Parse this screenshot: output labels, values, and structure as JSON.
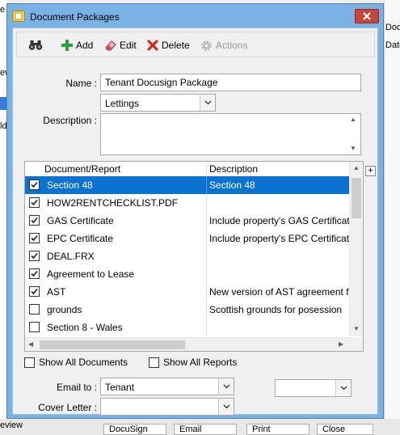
{
  "window": {
    "title": "Document Packages"
  },
  "toolbar": {
    "add_label": "Add",
    "edit_label": "Edit",
    "delete_label": "Delete",
    "actions_label": "Actions"
  },
  "form": {
    "name_label": "Name :",
    "name_value": "Tenant Docusign Package",
    "category_value": "Lettings",
    "description_label": "Description :",
    "description_value": ""
  },
  "grid": {
    "columns": [
      "Document/Report",
      "Description"
    ],
    "rows": [
      {
        "name": "Section 48",
        "description": "Section 48",
        "checked": true,
        "selected": true
      },
      {
        "name": "HOW2RENTCHECKLIST.PDF",
        "description": "",
        "checked": true,
        "selected": false
      },
      {
        "name": "GAS Certificate",
        "description": "Include property's GAS Certificat",
        "checked": true,
        "selected": false
      },
      {
        "name": "EPC Certificate",
        "description": "Include property's EPC Certificat",
        "checked": true,
        "selected": false
      },
      {
        "name": "DEAL.FRX",
        "description": "",
        "checked": true,
        "selected": false
      },
      {
        "name": "Agreement to Lease",
        "description": "",
        "checked": true,
        "selected": false
      },
      {
        "name": "AST",
        "description": "New version of AST agreement fo",
        "checked": true,
        "selected": false
      },
      {
        "name": "grounds",
        "description": "Scottish grounds for posession",
        "checked": false,
        "selected": false
      },
      {
        "name": "Section 8 - Wales",
        "description": "",
        "checked": false,
        "selected": false
      }
    ],
    "plus_label": "+"
  },
  "options": {
    "show_all_documents": "Show All Documents",
    "show_all_reports": "Show All Reports"
  },
  "email": {
    "email_to_label": "Email to :",
    "email_to_value": "Tenant",
    "secondary_value": "",
    "cover_letter_label": "Cover Letter :",
    "cover_letter_value": ""
  },
  "background": {
    "top_right_1": "Doc",
    "top_right_2": "Date",
    "left_1": "e",
    "left_2": "ew",
    "left_3": "e",
    "left_4": "ld",
    "bottom_left": "eview",
    "bottom_btn_1": "DocuSign",
    "bottom_btn_2": "Email",
    "bottom_btn_3": "Print",
    "bottom_btn_4": "Close"
  },
  "colors": {
    "title_bar": "#7ab2e6",
    "selection": "#0a73d2",
    "close_button": "#c7463c",
    "add_icon": "#2f9e3a",
    "delete_icon": "#d42a1e"
  }
}
